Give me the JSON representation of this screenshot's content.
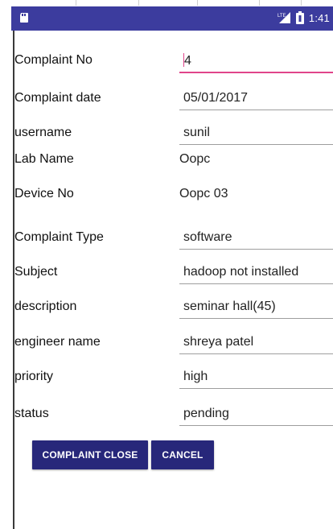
{
  "status_bar": {
    "time": "1:41",
    "background": "#3c3c9e",
    "icons": [
      "notification-icon",
      "signal-icon",
      "battery-icon"
    ]
  },
  "form": {
    "complaint_no": {
      "label": "Complaint No",
      "value": "4"
    },
    "complaint_date": {
      "label": "Complaint date",
      "value": "05/01/2017"
    },
    "username": {
      "label": "username",
      "value": "sunil"
    },
    "lab_name": {
      "label": "Lab Name",
      "value": "Oopc"
    },
    "device_no": {
      "label": "Device No",
      "value": "Oopc 03"
    },
    "complaint_type": {
      "label": "Complaint Type",
      "value": "software"
    },
    "subject": {
      "label": "Subject",
      "value": "hadoop not installed"
    },
    "description": {
      "label": "description",
      "value": "seminar hall(45)"
    },
    "engineer_name": {
      "label": "engineer name",
      "value": "shreya patel"
    },
    "priority": {
      "label": "priority",
      "value": "high"
    },
    "status": {
      "label": "status",
      "value": "pending"
    }
  },
  "buttons": {
    "complaint_close": "COMPLAINT CLOSE",
    "cancel": "CANCEL"
  },
  "colors": {
    "accent": "#e0448a",
    "button": "#27277a"
  }
}
